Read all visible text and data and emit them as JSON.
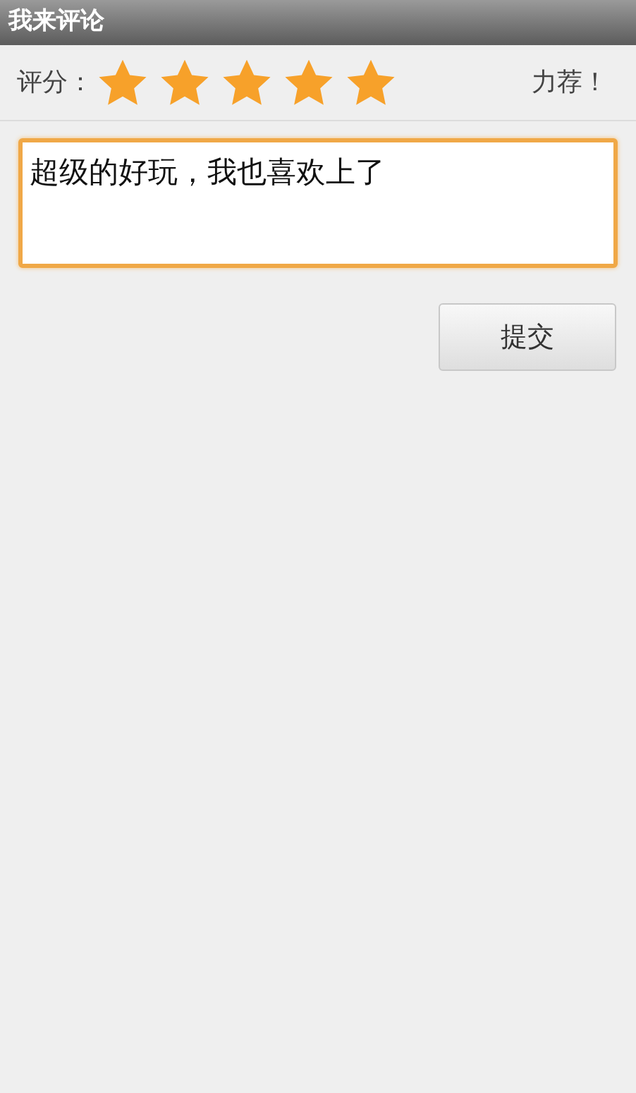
{
  "window": {
    "title": "我来评论"
  },
  "rating": {
    "label": "评分：",
    "stars": 5,
    "caption": "力荐！"
  },
  "comment": {
    "value": "超级的好玩，我也喜欢上了"
  },
  "buttons": [
    {
      "label": "提交"
    }
  ]
}
